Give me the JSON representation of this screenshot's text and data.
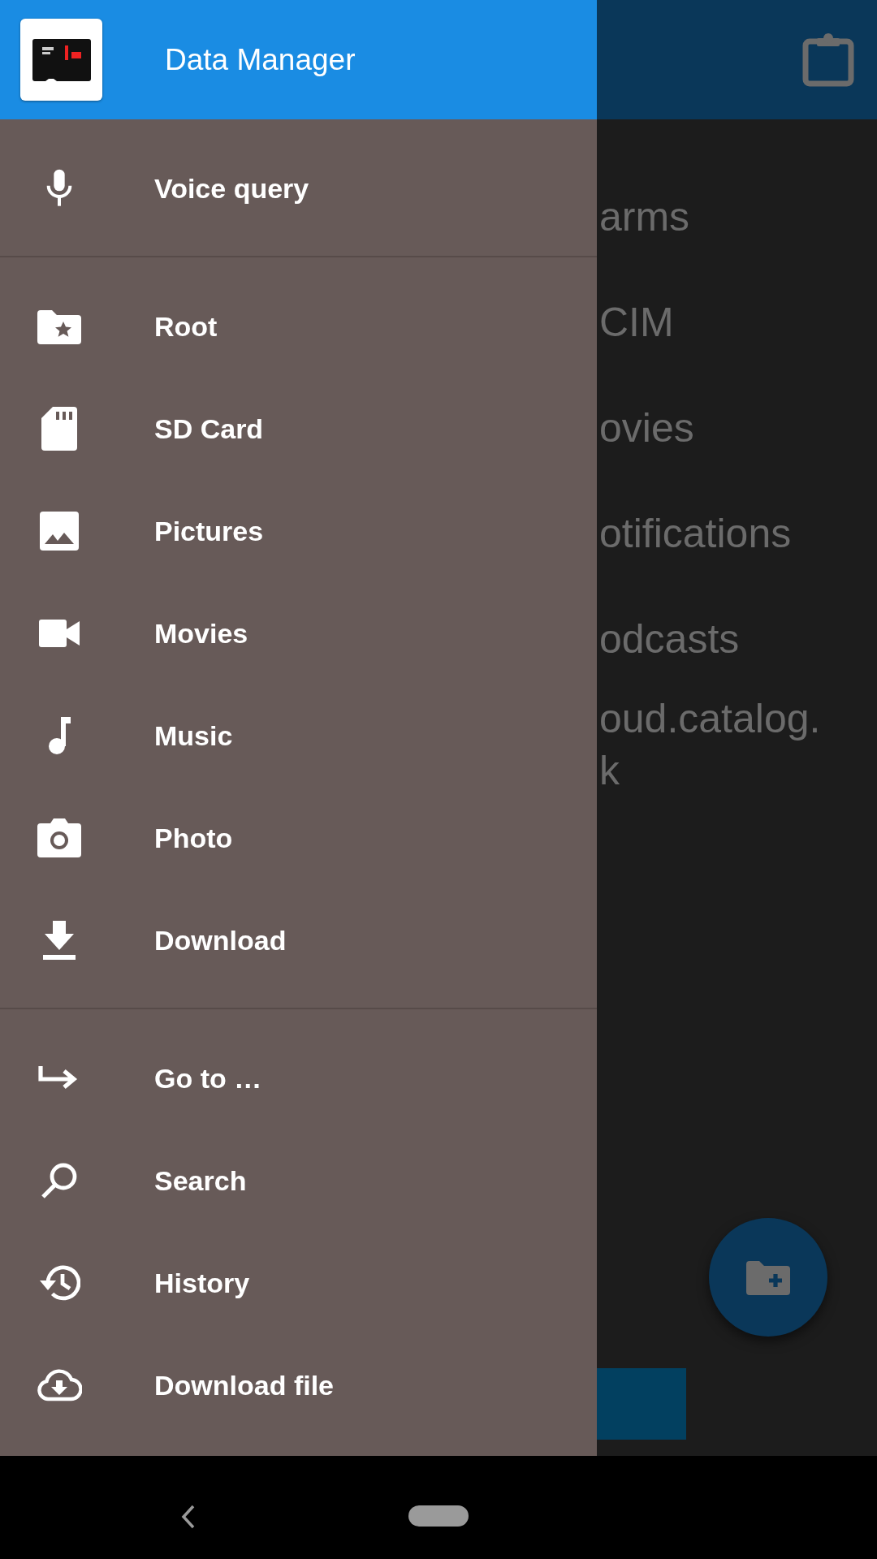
{
  "app_bar": {
    "kind": "dimmed"
  },
  "background_list": [
    {
      "lines": [
        "arms"
      ]
    },
    {
      "lines": [
        "CIM"
      ]
    },
    {
      "lines": [
        "ovies"
      ]
    },
    {
      "lines": [
        "otifications"
      ]
    },
    {
      "lines": [
        "odcasts"
      ]
    },
    {
      "lines": [
        "oud.catalog.",
        "k"
      ]
    }
  ],
  "drawer": {
    "title": "Data Manager",
    "sections": [
      [
        {
          "label": "Voice query"
        }
      ],
      [
        {
          "label": "Root"
        },
        {
          "label": "SD Card"
        },
        {
          "label": "Pictures"
        },
        {
          "label": "Movies"
        },
        {
          "label": "Music"
        },
        {
          "label": "Photo"
        },
        {
          "label": "Download"
        }
      ],
      [
        {
          "label": "Go to …"
        },
        {
          "label": "Search"
        },
        {
          "label": "History"
        },
        {
          "label": "Download file"
        }
      ]
    ]
  }
}
